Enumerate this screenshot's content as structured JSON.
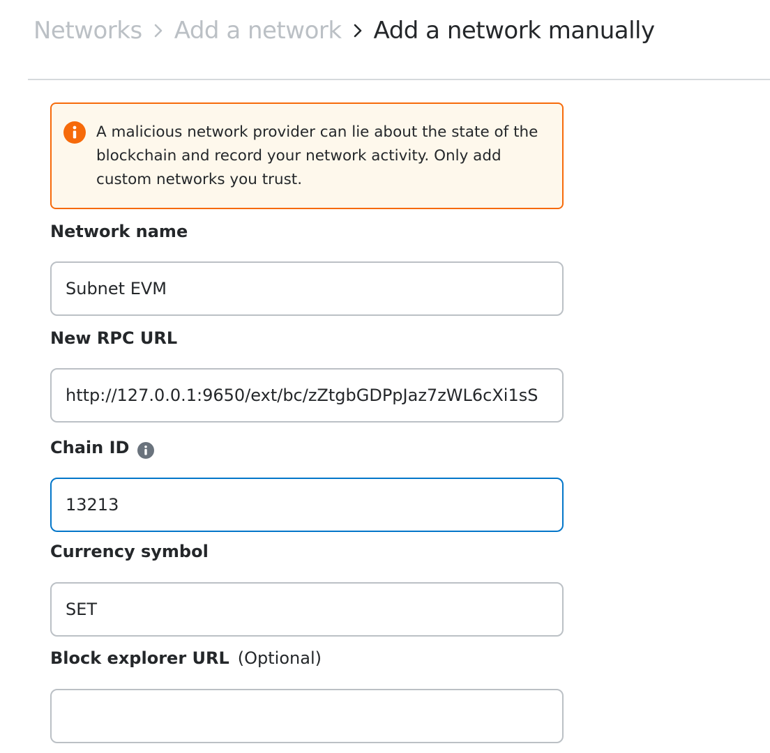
{
  "breadcrumb": {
    "items": [
      "Networks",
      "Add a network"
    ],
    "current": "Add a network manually"
  },
  "warning": {
    "icon": "info-circle-icon",
    "color": "#f66a0a",
    "text": "A malicious network provider can lie about the state of the blockchain and record your network activity. Only add custom networks you trust."
  },
  "form": {
    "network_name": {
      "label": "Network name",
      "value": "Subnet EVM"
    },
    "rpc_url": {
      "label": "New RPC URL",
      "value": "http://127.0.0.1:9650/ext/bc/zZtgbGDPpJaz7zWL6cXi1sS"
    },
    "chain_id": {
      "label": "Chain ID",
      "info_icon": "info-icon",
      "value": "13213"
    },
    "currency_symbol": {
      "label": "Currency symbol",
      "value": "SET"
    },
    "block_explorer": {
      "label": "Block explorer URL",
      "optional": "(Optional)",
      "value": ""
    }
  },
  "colors": {
    "accent": "#0376c9",
    "warning": "#f66a0a",
    "warning_bg": "#fef8ec",
    "muted": "#bbc0c5"
  }
}
